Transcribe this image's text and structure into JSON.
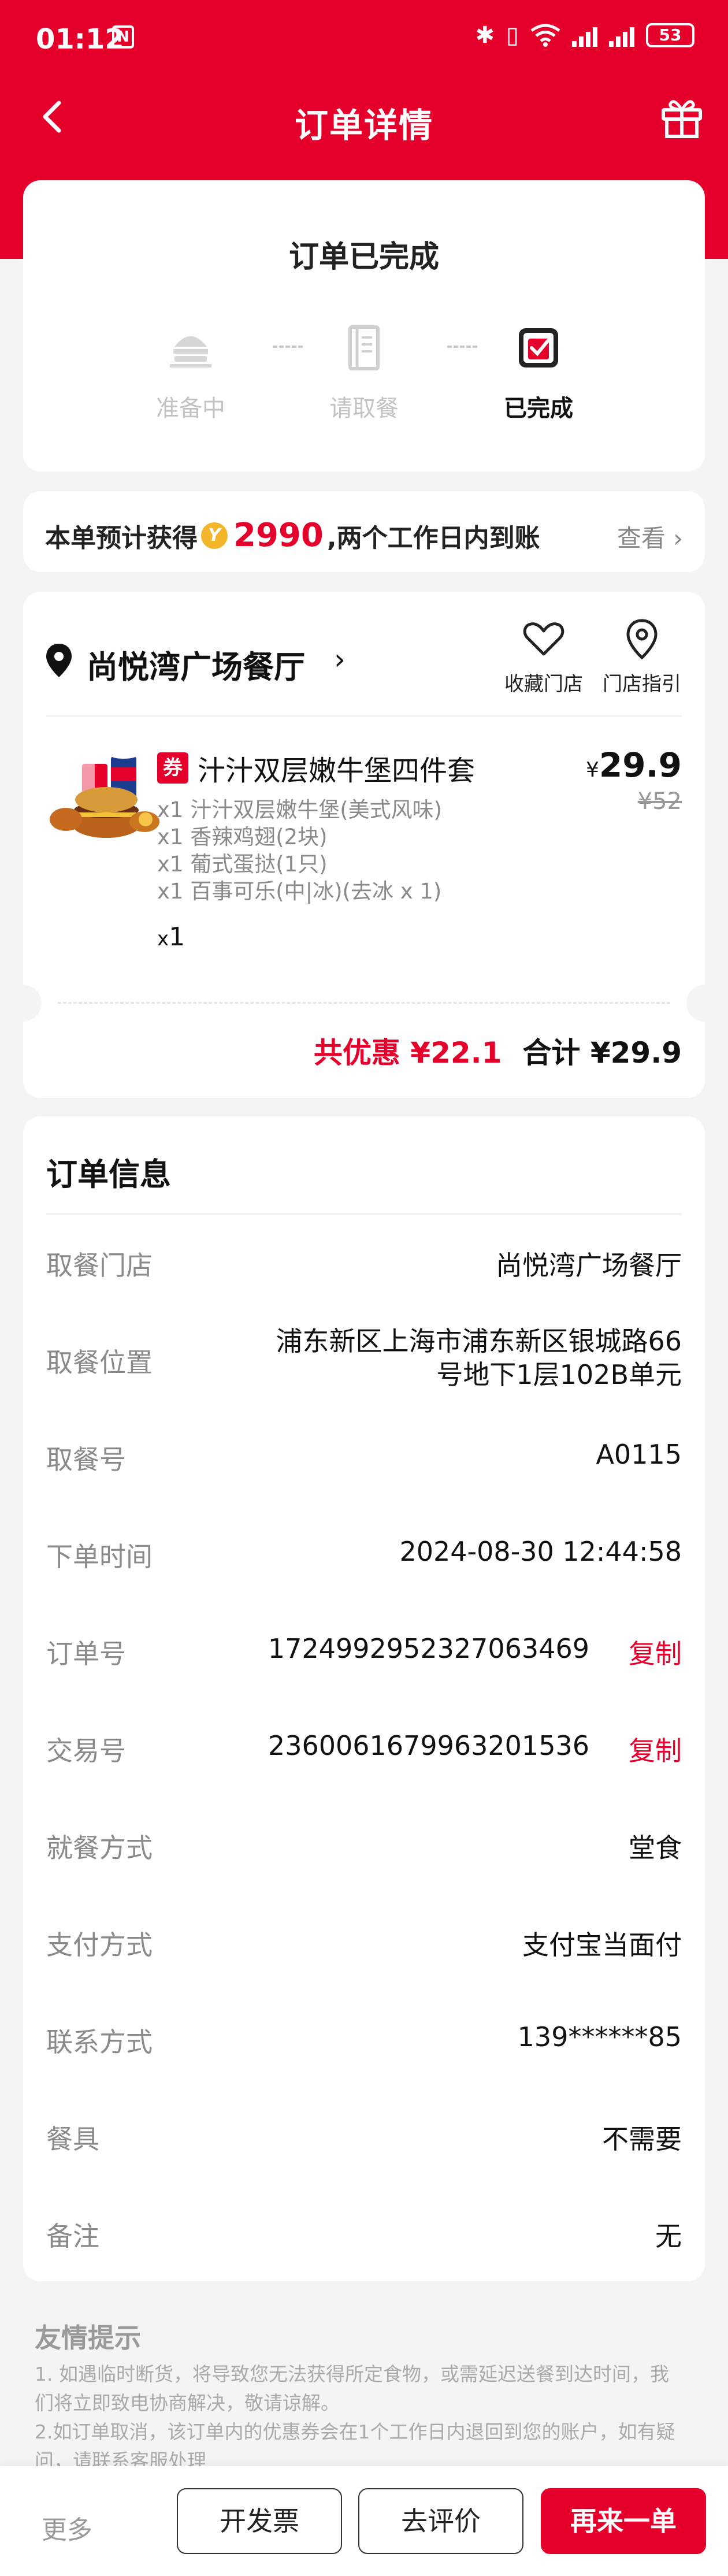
{
  "status_bar": {
    "time": "01:12",
    "notify_badge": "N",
    "battery": "53"
  },
  "header": {
    "title": "订单详情",
    "back_icon": "back-arrow-icon",
    "gift_icon": "gift-icon"
  },
  "order_status": {
    "title": "订单已完成",
    "steps": [
      {
        "label": "准备中",
        "icon": "burger-tray-icon",
        "done": false
      },
      {
        "label": "请取餐",
        "icon": "receipt-book-icon",
        "done": false
      },
      {
        "label": "已完成",
        "icon": "completed-bag-icon",
        "done": true
      }
    ]
  },
  "reward": {
    "prefix": "本单预计获得",
    "coin_icon": "coin-icon",
    "amount": "2990",
    "suffix": ",两个工作日内到账",
    "link": "查看",
    "accent_color": "#e4002b"
  },
  "store": {
    "name": "尚悦湾广场餐厅",
    "actions": [
      {
        "label": "收藏门店",
        "icon": "heart-icon"
      },
      {
        "label": "门店指引",
        "icon": "location-pin-icon"
      }
    ]
  },
  "meal": {
    "coupon_tag": "券",
    "name": "汁汁双层嫩牛堡四件套",
    "currency": "¥",
    "price": "29.9",
    "original_price": "¥52",
    "items": [
      "x1 汁汁双层嫩牛堡(美式风味)",
      "x1 香辣鸡翅(2块)",
      "x1 葡式蛋挞(1只)",
      "x1 百事可乐(中|冰)(去冰 x 1)"
    ],
    "qty_prefix": "x",
    "qty": "1"
  },
  "totals": {
    "discount": "共优惠 ¥22.1",
    "total": "合计 ¥29.9"
  },
  "order_info": {
    "title": "订单信息",
    "rows": [
      {
        "label": "取餐门店",
        "value": "尚悦湾广场餐厅"
      },
      {
        "label": "取餐位置",
        "value_line1": "浦东新区上海市浦东新区银城路66",
        "value_line2": "号地下1层102B单元"
      },
      {
        "label": "取餐号",
        "value": "A0115"
      },
      {
        "label": "下单时间",
        "value": "2024-08-30 12:44:58"
      },
      {
        "label": "订单号",
        "value": "1724992952327063469",
        "action": "复制"
      },
      {
        "label": "交易号",
        "value": "2360061679963201536",
        "action": "复制"
      },
      {
        "label": "就餐方式",
        "value": "堂食"
      },
      {
        "label": "支付方式",
        "value": "支付宝当面付"
      },
      {
        "label": "联系方式",
        "value": "139******85"
      },
      {
        "label": "餐具",
        "value": "不需要"
      },
      {
        "label": "备注",
        "value": "无"
      }
    ]
  },
  "tips": {
    "title": "友情提示",
    "lines": [
      "1. 如遇临时断货，将导致您无法获得所定食物，或需延迟送餐到达时间，我",
      "们将立即致电协商解决，敬请谅解。",
      "2.如订单取消，该订单内的优惠券会在1个工作日内退回到您的账户，如有疑",
      "问，请联系客服处理"
    ]
  },
  "bottom_bar": {
    "more": "更多",
    "invoice": "开发票",
    "review": "去评价",
    "reorder": "再来一单"
  }
}
